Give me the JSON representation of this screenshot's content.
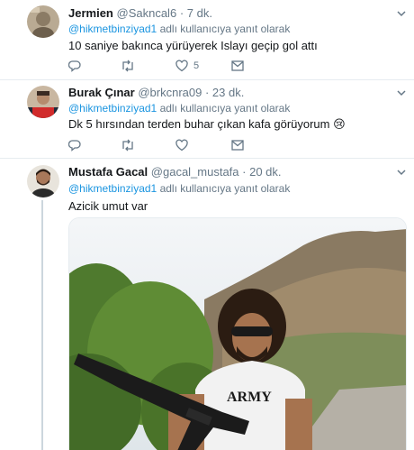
{
  "tweets": [
    {
      "name": "Jermien",
      "handle": "@Sakncal6",
      "time": "· 7 dk.",
      "reply_mention": "@hikmetbinziyad1",
      "reply_suffix": " adlı kullanıcıya yanıt olarak",
      "text": "10 saniye bakınca yürüyerek Islayı geçip gol attı",
      "like_count": "5"
    },
    {
      "name": "Burak Çınar",
      "handle": "@brkcnra09",
      "time": "· 23 dk.",
      "reply_mention": "@hikmetbinziyad1",
      "reply_suffix": " adlı kullanıcıya yanıt olarak",
      "text": "Dk 5 hırsından terden buhar çıkan kafa görüyorum 😢",
      "like_count": ""
    },
    {
      "name": "Mustafa Gacal",
      "handle": "@gacal_mustafa",
      "time": "· 20 dk.",
      "reply_mention": "@hikmetbinziyad1",
      "reply_suffix": " adlı kullanıcıya yanıt olarak",
      "text": "Azicik umut var",
      "media_shirt_text": "ARMY"
    }
  ],
  "icons": [
    "chevron-down-icon",
    "reply-icon",
    "retweet-icon",
    "like-icon",
    "message-icon"
  ],
  "colors": {
    "accent": "#1b95e0",
    "muted": "#657786",
    "text": "#14171a",
    "divider": "#e6ecf0",
    "thread_line": "#ccd6dd"
  }
}
